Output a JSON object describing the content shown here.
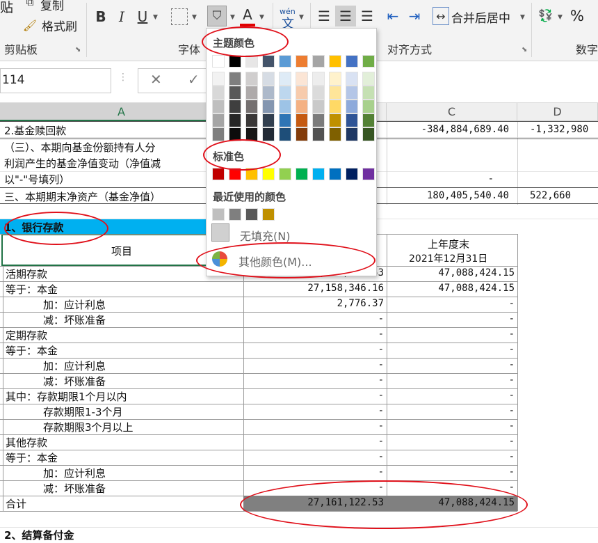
{
  "ribbon": {
    "paste_label": "贴",
    "copy_label": "复制",
    "format_painter_label": "格式刷",
    "merge_center_label": "合并后居中",
    "percent_label": "%",
    "phonetic_top": "wén",
    "phonetic_bottom": "文",
    "groups": {
      "clipboard": "剪贴板",
      "font": "字体",
      "alignment": "对齐方式",
      "number": "数字"
    }
  },
  "formula_bar": {
    "name_box": "114",
    "cancel": "✕",
    "confirm": "✓"
  },
  "columns": [
    "A",
    "C",
    "D"
  ],
  "top_rows": [
    {
      "a": "2.基金赎回款",
      "c": "-384,884,689.40",
      "d": "-1,332,980"
    },
    {
      "a": "（三）、本期向基金份额持有人分",
      "c": "",
      "d": ""
    },
    {
      "a": "利润产生的基金净值变动（净值减",
      "c": "",
      "d": ""
    },
    {
      "a": "以\"-\"号填列）",
      "c": "-",
      "d": ""
    },
    {
      "a": "三、本期期末净资产（基金净值）",
      "c": "180,405,540.40",
      "d": "522,660"
    }
  ],
  "section1_title": "1、银行存款",
  "table": {
    "col_item_header": "项目",
    "col_prev_header_line1": "上年度末",
    "col_prev_header_line2": "2021年12月31日",
    "rows": [
      {
        "item": "活期存款",
        "cur": "27,161,122.53",
        "prev": "47,088,424.15",
        "indent": false
      },
      {
        "item": "等于：本金",
        "cur": "27,158,346.16",
        "prev": "47,088,424.15",
        "indent": false
      },
      {
        "item": "加：应计利息",
        "cur": "2,776.37",
        "prev": "-",
        "indent": true
      },
      {
        "item": "减：坏账准备",
        "cur": "-",
        "prev": "-",
        "indent": true
      },
      {
        "item": "定期存款",
        "cur": "-",
        "prev": "-",
        "indent": false
      },
      {
        "item": "等于：本金",
        "cur": "-",
        "prev": "-",
        "indent": false
      },
      {
        "item": "加：应计利息",
        "cur": "-",
        "prev": "-",
        "indent": true
      },
      {
        "item": "减：坏账准备",
        "cur": "-",
        "prev": "-",
        "indent": true
      },
      {
        "item": "其中：存款期限1个月以内",
        "cur": "-",
        "prev": "-",
        "indent": false
      },
      {
        "item": "存款期限1-3个月",
        "cur": "-",
        "prev": "-",
        "indent": true
      },
      {
        "item": "存款期限3个月以上",
        "cur": "-",
        "prev": "-",
        "indent": true
      },
      {
        "item": "其他存款",
        "cur": "-",
        "prev": "-",
        "indent": false
      },
      {
        "item": "等于：本金",
        "cur": "-",
        "prev": "-",
        "indent": false
      },
      {
        "item": "加：应计利息",
        "cur": "-",
        "prev": "-",
        "indent": true
      },
      {
        "item": "减：坏账准备",
        "cur": "-",
        "prev": "-",
        "indent": true
      }
    ],
    "total": {
      "item": "合计",
      "cur": "27,161,122.53",
      "prev": "47,088,424.15"
    }
  },
  "section2_title": "2、结算备付金",
  "color_picker": {
    "theme_title": "主题颜色",
    "standard_title": "标准色",
    "recent_title": "最近使用的颜色",
    "no_fill_label": "无填充(N)",
    "more_colors_label": "其他颜色(M)...",
    "theme_top": [
      "#ffffff",
      "#000000",
      "#e7e6e6",
      "#44546a",
      "#5b9bd5",
      "#ed7d31",
      "#a5a5a5",
      "#ffc000",
      "#4472c4",
      "#70ad47"
    ],
    "theme_shades": [
      [
        "#f2f2f2",
        "#7f7f7f",
        "#d0cece",
        "#d6dce4",
        "#deebf6",
        "#fbe5d5",
        "#ededed",
        "#fff2cc",
        "#d9e2f3",
        "#e2efd9"
      ],
      [
        "#d8d8d8",
        "#595959",
        "#aeaaaa",
        "#adb9ca",
        "#bdd7ee",
        "#f7cbac",
        "#dbdbdb",
        "#fee599",
        "#b4c6e7",
        "#c5e0b3"
      ],
      [
        "#bfbfbf",
        "#3f3f3f",
        "#757070",
        "#8496b0",
        "#9dc3e6",
        "#f4b183",
        "#c9c9c9",
        "#ffd965",
        "#8eaadb",
        "#a8d08d"
      ],
      [
        "#a5a5a5",
        "#262626",
        "#3a3838",
        "#323f4f",
        "#2e75b5",
        "#c55a11",
        "#7b7b7b",
        "#bf9000",
        "#2f5496",
        "#538135"
      ],
      [
        "#7f7f7f",
        "#0c0c0c",
        "#171616",
        "#222a35",
        "#1e4e79",
        "#833c0b",
        "#525252",
        "#7f6000",
        "#1f3864",
        "#375623"
      ]
    ],
    "standard": [
      "#c00000",
      "#ff0000",
      "#ffc000",
      "#ffff00",
      "#92d050",
      "#00b050",
      "#00b0f0",
      "#0070c0",
      "#002060",
      "#7030a0"
    ],
    "recent": [
      "#bfbfbf",
      "#7f7f7f",
      "#595959",
      "#bf9000"
    ]
  },
  "colors": {
    "section_highlight": "#00b0f0",
    "total_fill": "#808080",
    "annotation_red": "#e0101a",
    "excel_green": "#217346"
  }
}
